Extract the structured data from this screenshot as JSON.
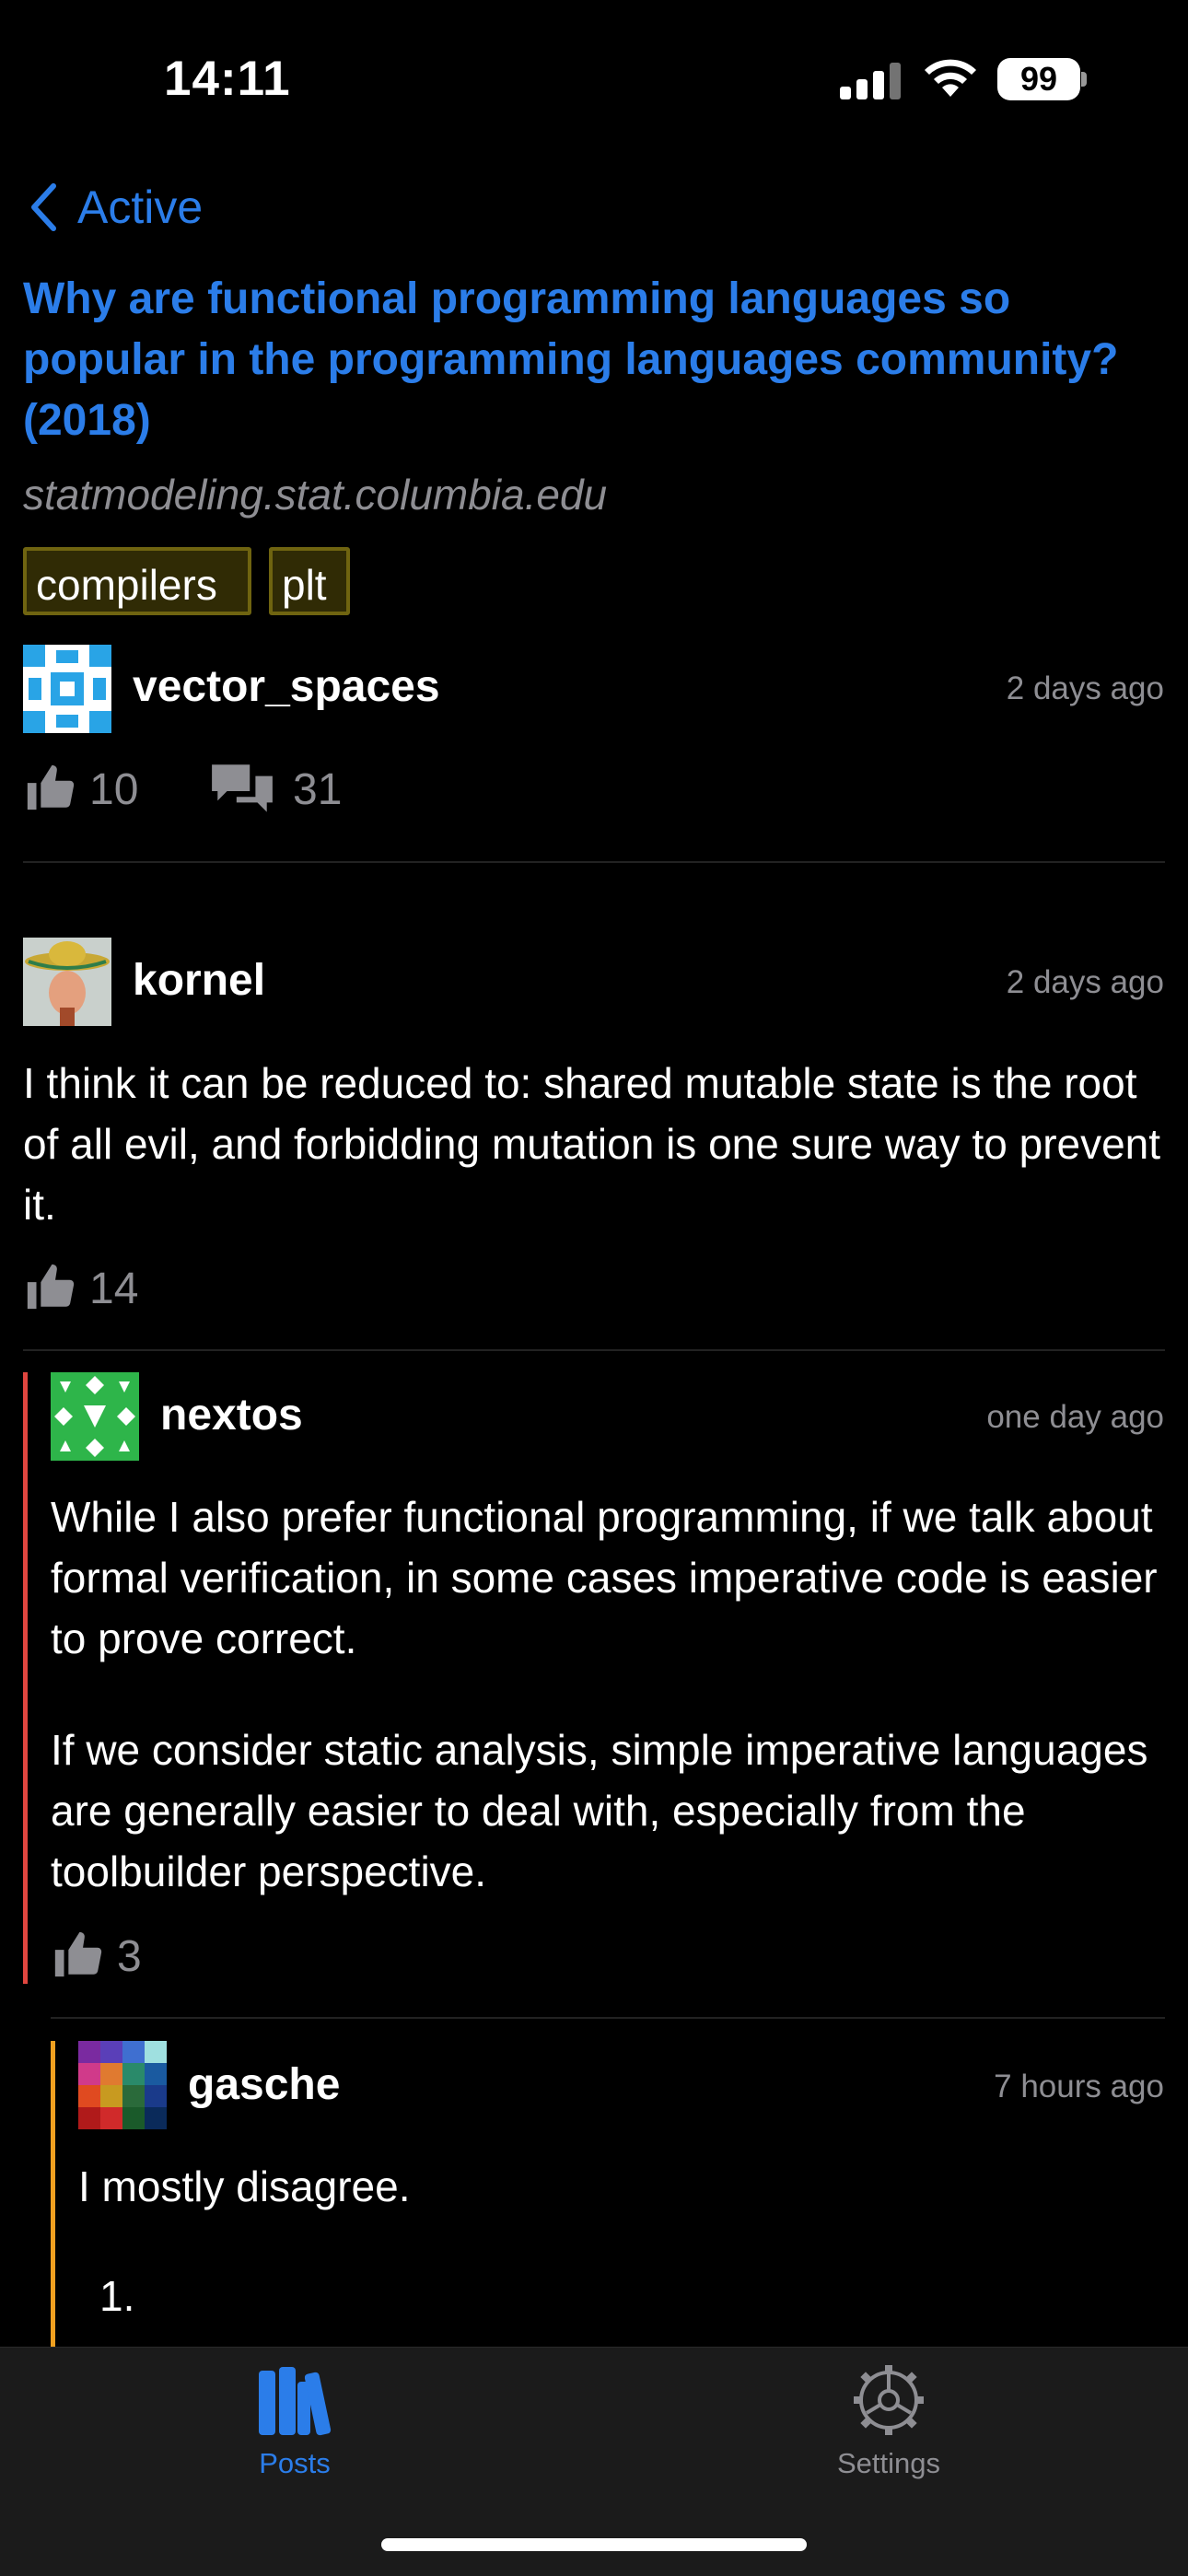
{
  "status": {
    "time": "14:11",
    "battery": "99"
  },
  "nav": {
    "back_label": "Active"
  },
  "post": {
    "title": "Why are functional programming languages so popular in the programming languages community? (2018)",
    "domain": "statmodeling.stat.columbia.edu",
    "tags": [
      "compilers",
      "plt"
    ],
    "author": "vector_spaces",
    "time": "2 days ago",
    "likes": "10",
    "comments": "31"
  },
  "comments": [
    {
      "author": "kornel",
      "time": "2 days ago",
      "text": "I think it can be reduced to: shared mutable state is the root of all evil, and forbidding mutation is one sure way to prevent it.",
      "likes": "14"
    },
    {
      "author": "nextos",
      "time": "one day ago",
      "p1": "While I also prefer functional programming, if we talk about formal verification, in some cases imperative code is easier to prove correct.",
      "p2": "If we consider static analysis, simple imperative languages are generally easier to deal with, especially from the toolbuilder perspective.",
      "likes": "3"
    },
    {
      "author": "gasche",
      "time": "7 hours ago",
      "text": "I mostly disagree.",
      "list_marker": "1."
    }
  ],
  "tabs": {
    "posts": "Posts",
    "settings": "Settings"
  },
  "colors": {
    "accent": "#2b7de9",
    "bar_level1": "#e0463f",
    "bar_level2": "#f0a020",
    "tag_border": "#6f6410"
  }
}
